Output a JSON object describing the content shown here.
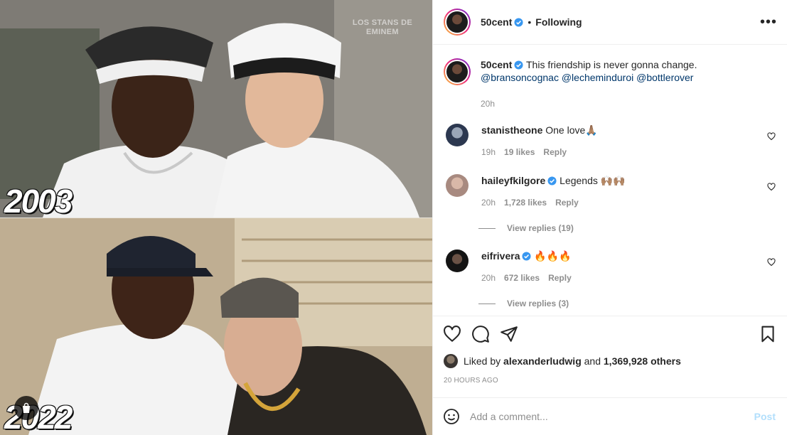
{
  "media": {
    "watermark_line1": "LOS STANS DE",
    "watermark_line2": "EMINEM",
    "year_top": "2003",
    "year_bottom": "2022",
    "shop_icon": "shopping-bag-icon"
  },
  "header": {
    "username": "50cent",
    "verified": true,
    "separator": "•",
    "follow_status": "Following",
    "more_label": "•••"
  },
  "caption": {
    "username": "50cent",
    "text": "This friendship is never gonna change.",
    "mentions": [
      "@bransoncognac",
      "@lecheminduroi",
      "@bottlerover"
    ],
    "time": "20h"
  },
  "comments": [
    {
      "username": "stanistheone",
      "verified": false,
      "text": "One love🙏🏽",
      "time": "19h",
      "likes": "19 likes",
      "reply_label": "Reply",
      "avatar_color": "#3a4a6a"
    },
    {
      "username": "haileyfkilgore",
      "verified": true,
      "text": "Legends 🙌🏽🙌🏽",
      "time": "20h",
      "likes": "1,728 likes",
      "reply_label": "Reply",
      "view_replies": "View replies (19)",
      "avatar_color": "#c9a89a"
    },
    {
      "username": "eifrivera",
      "verified": true,
      "text": "🔥🔥🔥",
      "time": "20h",
      "likes": "672 likes",
      "reply_label": "Reply",
      "view_replies": "View replies (3)",
      "avatar_color": "#2a2a2a"
    }
  ],
  "actions": {
    "liked_by_prefix": "Liked by",
    "liked_by_user": "alexanderludwig",
    "liked_by_and": "and",
    "liked_by_others": "1,369,928 others",
    "time_ago": "20 HOURS AGO"
  },
  "add_comment": {
    "placeholder": "Add a comment...",
    "post_label": "Post"
  },
  "colors": {
    "link": "#00376b",
    "verified": "#3897f0",
    "muted": "#8e8e8e",
    "post_disabled": "#b2dffc"
  }
}
